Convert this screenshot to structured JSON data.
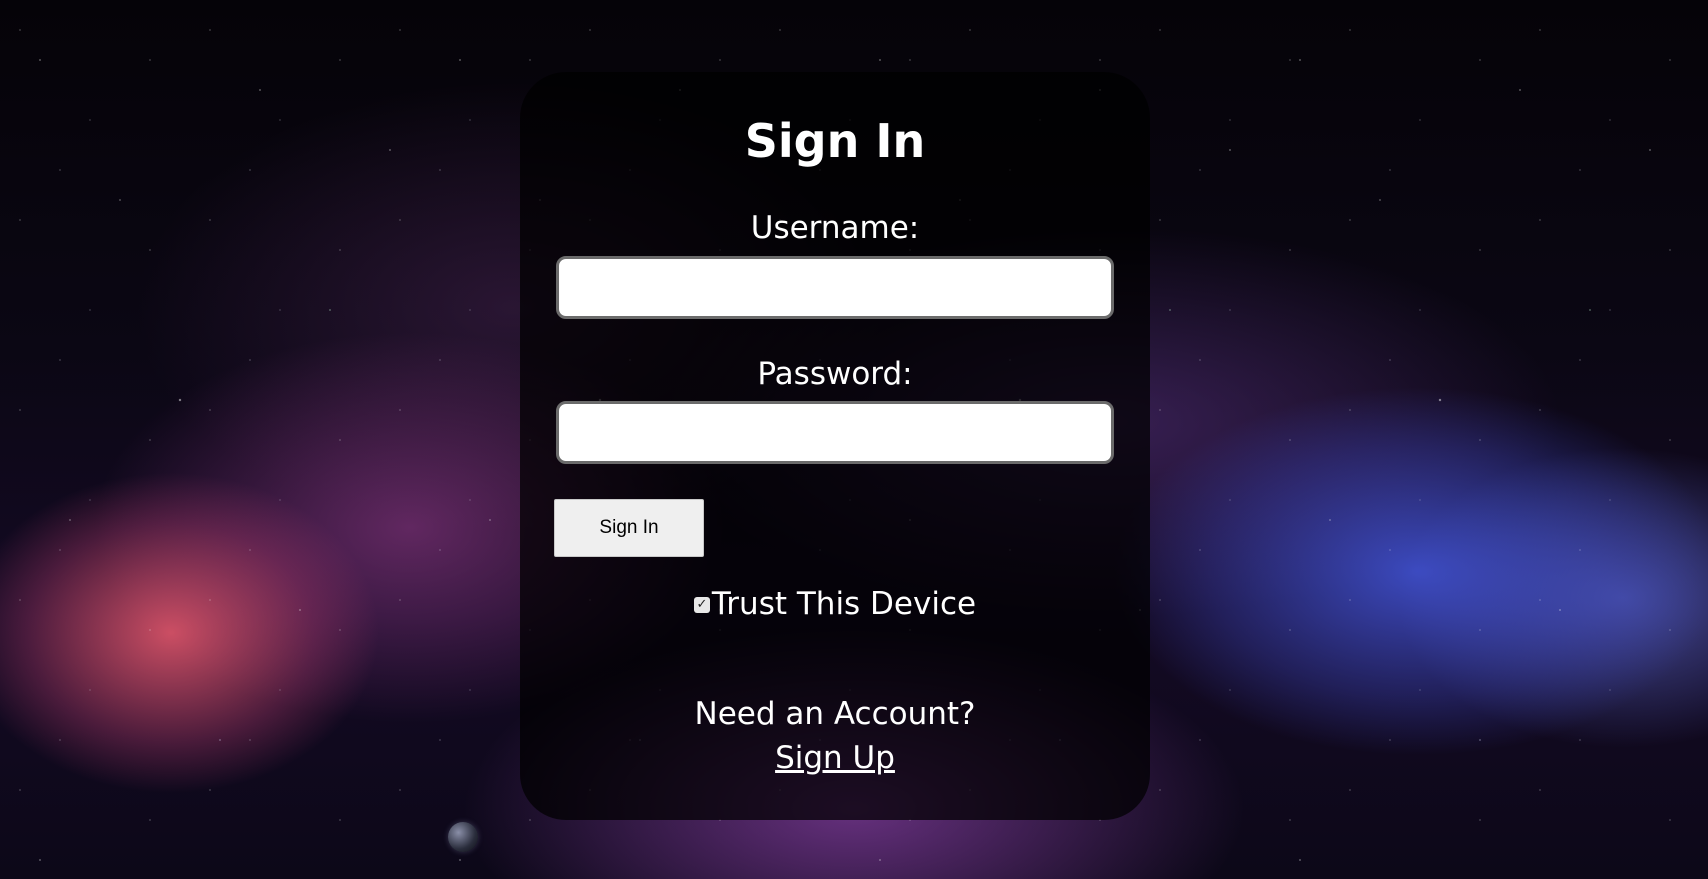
{
  "background": {
    "theme": "galaxy-nebula",
    "accent_colors": [
      "#e85a6e",
      "#4a5ae6",
      "#8c46b4"
    ]
  },
  "form": {
    "title": "Sign In",
    "username_label": "Username:",
    "username_value": "",
    "password_label": "Password:",
    "password_value": "",
    "submit_label": "Sign In",
    "trust_device_label": "Trust This Device",
    "trust_device_checked": true,
    "checkbox_glyph": "✓",
    "need_account_text": "Need an Account?",
    "signup_link_label": "Sign Up"
  },
  "colors": {
    "card_background": "rgba(0,0,0,0.72)",
    "text": "#ffffff",
    "button_background": "#efefef"
  }
}
